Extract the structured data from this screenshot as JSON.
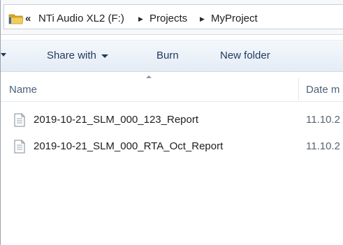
{
  "address_bar": {
    "overflow_label": "«",
    "crumbs": [
      "NTi Audio XL2 (F:)",
      "Projects",
      "MyProject"
    ]
  },
  "toolbar": {
    "share_label": "Share with",
    "burn_label": "Burn",
    "new_folder_label": "New folder"
  },
  "columns": {
    "name": "Name",
    "date": "Date m"
  },
  "files": [
    {
      "name": "2019-10-21_SLM_000_123_Report",
      "date": "11.10.2"
    },
    {
      "name": "2019-10-21_SLM_000_RTA_Oct_Report",
      "date": "11.10.2"
    }
  ],
  "icons": {
    "folder": "folder-icon",
    "file": "text-document-icon",
    "separator": "breadcrumb-separator-icon"
  },
  "colors": {
    "toolbar_text": "#1e395b",
    "header_text": "#4c607a",
    "folder_yellow": "#e8b93a"
  }
}
